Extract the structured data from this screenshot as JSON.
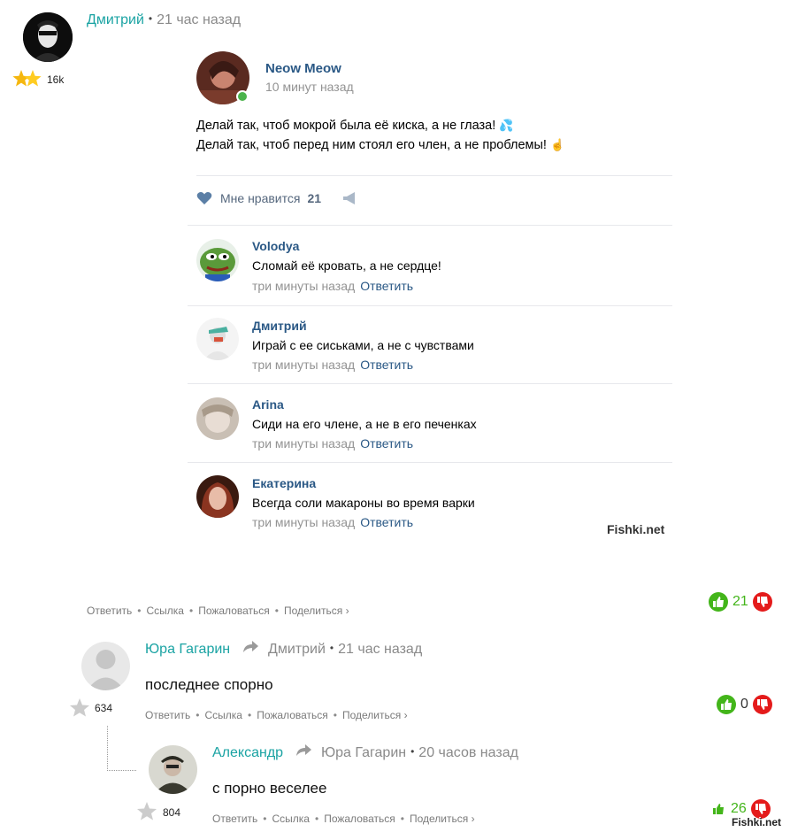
{
  "comment1": {
    "author": "Дмитрий",
    "time": "21 час назад",
    "rating": "16k",
    "actions": [
      "Ответить",
      "Ссылка",
      "Пожаловаться",
      "Поделиться"
    ],
    "votes": "21",
    "embed": {
      "post_author": "Neow Meow",
      "post_time": "10 минут назад",
      "post_line1": "Делай так, чтоб мокрой была её киска, а не глаза!",
      "post_line2": "Делай так, чтоб перед ним стоял его член, а не проблемы!",
      "like_label": "Мне нравится",
      "like_count": "21",
      "comments": [
        {
          "name": "Volodya",
          "text": "Сломай её кровать, а не сердце!",
          "time": "три минуты назад",
          "reply": "Ответить"
        },
        {
          "name": "Дмитрий",
          "text": "Играй с ее сиськами, а не с чувствами",
          "time": "три минуты назад",
          "reply": "Ответить"
        },
        {
          "name": "Arina",
          "text": "Сиди на его члене, а не в его печенках",
          "time": "три минуты назад",
          "reply": "Ответить"
        },
        {
          "name": "Екатерина",
          "text": "Всегда соли макароны во время варки",
          "time": "три минуты назад",
          "reply": "Ответить"
        }
      ],
      "watermark": "Fishki.net"
    }
  },
  "comment2": {
    "author": "Юра Гагарин",
    "reply_to": "Дмитрий",
    "time": "21 час назад",
    "text": "последнее спорно",
    "rating": "634",
    "actions": [
      "Ответить",
      "Ссылка",
      "Пожаловаться",
      "Поделиться"
    ],
    "votes": "0"
  },
  "comment3": {
    "author": "Александр",
    "reply_to": "Юра Гагарин",
    "time": "20 часов назад",
    "text": "с порно веселее",
    "rating": "804",
    "actions": [
      "Ответить",
      "Ссылка",
      "Пожаловаться",
      "Поделиться"
    ],
    "votes": "26"
  },
  "watermark_bottom": "Fishki.net",
  "colors": {
    "author": "#1aa3a3",
    "vk_link": "#2a5885",
    "upvote": "#43b51a",
    "downvote": "#e41b1b"
  }
}
